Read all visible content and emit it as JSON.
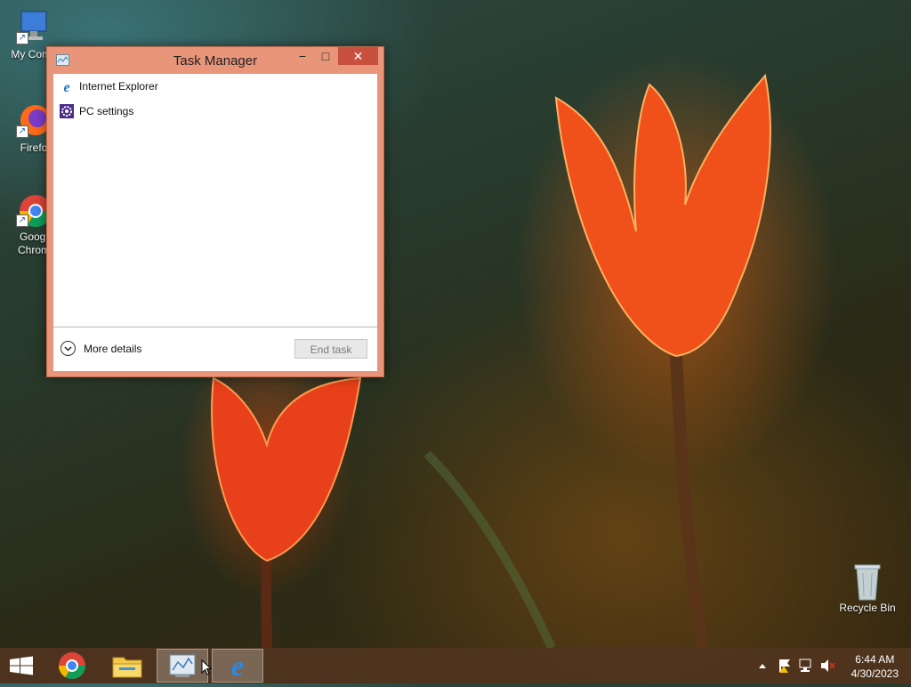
{
  "desktop": {
    "icons": [
      {
        "label": "My Comp"
      },
      {
        "label": "Firefo"
      },
      {
        "label": "Googl Chrom"
      },
      {
        "label": "Recycle Bin"
      }
    ]
  },
  "window": {
    "title": "Task Manager",
    "minimize": "−",
    "maximize": "□",
    "close": "✕",
    "apps": [
      {
        "name": "Internet Explorer",
        "icon": "internet-explorer-icon"
      },
      {
        "name": "PC settings",
        "icon": "gear-icon"
      }
    ],
    "more_details": "More details",
    "end_task": "End task"
  },
  "taskbar": {
    "items": [
      "start-button",
      "chrome",
      "file-explorer",
      "task-manager",
      "internet-explorer"
    ],
    "clock_time": "6:44 AM",
    "clock_date": "4/30/2023"
  },
  "colors": {
    "window_border": "#e8957a",
    "close_button": "#c7503f",
    "taskbar": "#50341e"
  }
}
